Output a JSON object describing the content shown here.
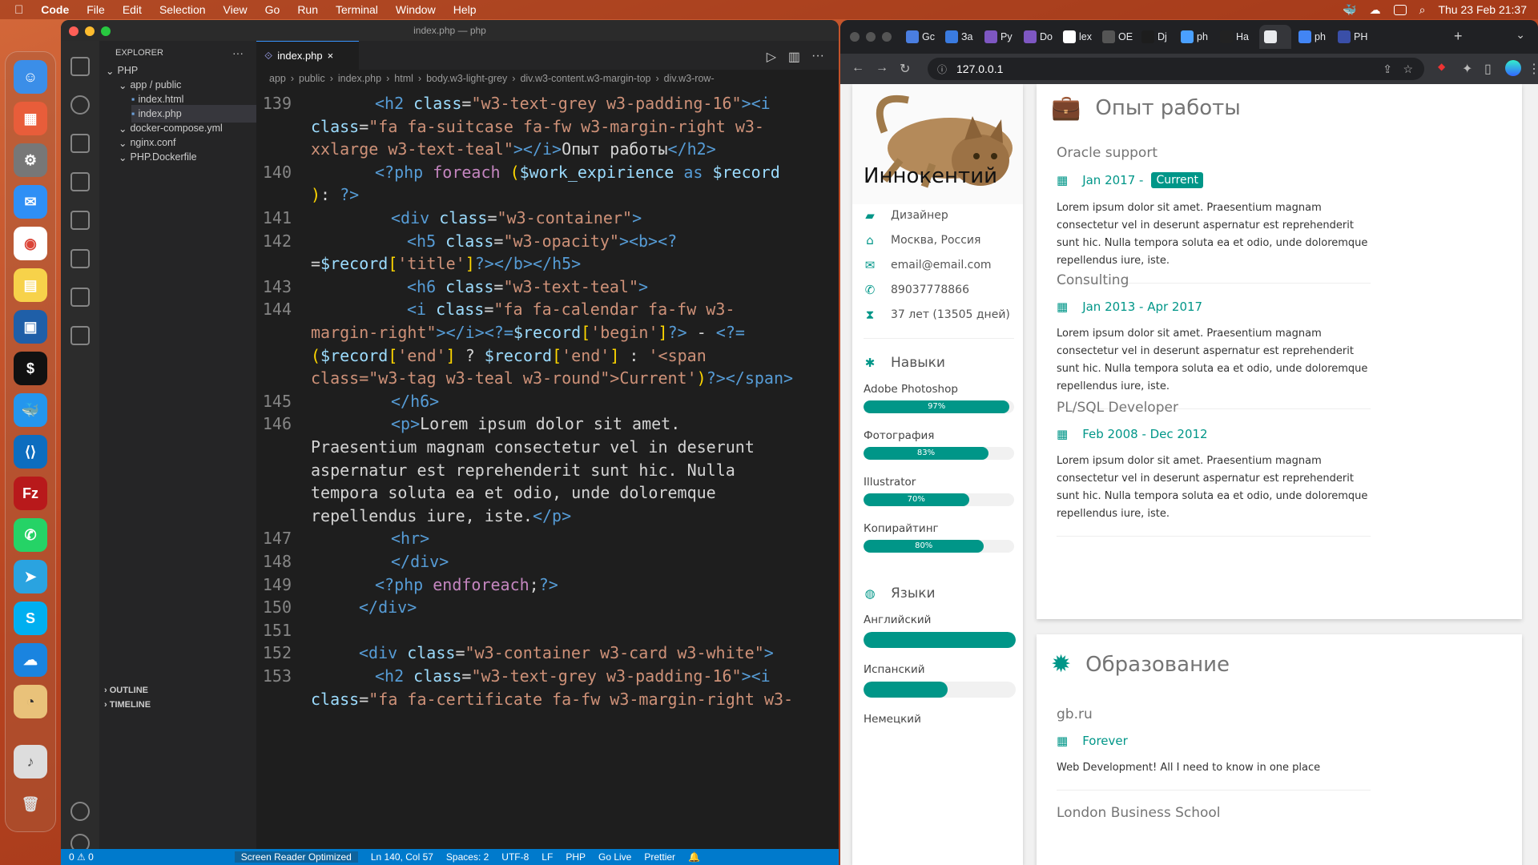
{
  "menubar": {
    "app": "Code",
    "items": [
      "File",
      "Edit",
      "Selection",
      "View",
      "Go",
      "Run",
      "Terminal",
      "Window",
      "Help"
    ],
    "clock": "Thu 23 Feb 21:37"
  },
  "vscode": {
    "title": "index.php — php",
    "explorer_label": "EXPLORER",
    "tree": [
      {
        "label": "PHP",
        "depth": 0
      },
      {
        "label": "app / public",
        "depth": 1
      },
      {
        "label": "index.html",
        "depth": 2
      },
      {
        "label": "index.php",
        "depth": 2,
        "active": true
      },
      {
        "label": "docker-compose.yml",
        "depth": 1
      },
      {
        "label": "nginx.conf",
        "depth": 1
      },
      {
        "label": "PHP.Dockerfile",
        "depth": 1
      }
    ],
    "outline": "OUTLINE",
    "timeline": "TIMELINE",
    "tab": "index.php",
    "breadcrumbs": [
      "app",
      "public",
      "index.php",
      "html",
      "body.w3-light-grey",
      "div.w3-content.w3-margin-top",
      "div.w3-row-"
    ],
    "lines": [
      {
        "n": "139",
        "parts": [
          [
            "t",
            "<h2 "
          ],
          [
            "a",
            "class"
          ],
          [
            "p",
            "="
          ],
          [
            "s",
            "\"w3-text-grey w3-padding-16\""
          ],
          [
            "t",
            "><i"
          ]
        ]
      },
      {
        "n": "",
        "parts": [
          [
            "a",
            "class"
          ],
          [
            "p",
            "="
          ],
          [
            "s",
            "\"fa fa-suitcase fa-fw w3-margin-right w3-"
          ]
        ]
      },
      {
        "n": "",
        "parts": [
          [
            "s",
            "xxlarge w3-text-teal\""
          ],
          [
            "t",
            "></i>"
          ],
          [
            "p",
            "Опыт работы"
          ],
          [
            "t",
            "</h2>"
          ]
        ]
      },
      {
        "n": "140",
        "parts": [
          [
            "t",
            "<?php "
          ],
          [
            "k",
            "foreach "
          ],
          [
            "y",
            "("
          ],
          [
            "v",
            "$work_expirience "
          ],
          [
            "t",
            "as "
          ],
          [
            "v",
            "$record"
          ]
        ]
      },
      {
        "n": "",
        "parts": [
          [
            "y",
            ")"
          ],
          [
            "p",
            ": "
          ],
          [
            "t",
            "?>"
          ]
        ]
      },
      {
        "n": "141",
        "parts": [
          [
            "t",
            "<div "
          ],
          [
            "a",
            "class"
          ],
          [
            "p",
            "="
          ],
          [
            "s",
            "\"w3-container\""
          ],
          [
            "t",
            ">"
          ]
        ]
      },
      {
        "n": "142",
        "parts": [
          [
            "t",
            "<h5 "
          ],
          [
            "a",
            "class"
          ],
          [
            "p",
            "="
          ],
          [
            "s",
            "\"w3-opacity\""
          ],
          [
            "t",
            "><b><?"
          ]
        ]
      },
      {
        "n": "",
        "parts": [
          [
            "p",
            "="
          ],
          [
            "v",
            "$record"
          ],
          [
            "y",
            "["
          ],
          [
            "s",
            "'title'"
          ],
          [
            "y",
            "]"
          ],
          [
            "t",
            "?></b></h5>"
          ]
        ]
      },
      {
        "n": "143",
        "parts": [
          [
            "t",
            "<h6 "
          ],
          [
            "a",
            "class"
          ],
          [
            "p",
            "="
          ],
          [
            "s",
            "\"w3-text-teal\""
          ],
          [
            "t",
            ">"
          ]
        ]
      },
      {
        "n": "144",
        "parts": [
          [
            "t",
            "<i "
          ],
          [
            "a",
            "class"
          ],
          [
            "p",
            "="
          ],
          [
            "s",
            "\"fa fa-calendar fa-fw w3-"
          ]
        ]
      },
      {
        "n": "",
        "parts": [
          [
            "s",
            "margin-right\""
          ],
          [
            "t",
            "></i><?="
          ],
          [
            "v",
            "$record"
          ],
          [
            "y",
            "["
          ],
          [
            "s",
            "'begin'"
          ],
          [
            "y",
            "]"
          ],
          [
            "t",
            "?>"
          ],
          [
            "p",
            " - "
          ],
          [
            "t",
            "<?="
          ]
        ]
      },
      {
        "n": "",
        "parts": [
          [
            "y",
            "("
          ],
          [
            "v",
            "$record"
          ],
          [
            "y",
            "["
          ],
          [
            "s",
            "'end'"
          ],
          [
            "y",
            "]"
          ],
          [
            "p",
            " ? "
          ],
          [
            "v",
            "$record"
          ],
          [
            "y",
            "["
          ],
          [
            "s",
            "'end'"
          ],
          [
            "y",
            "]"
          ],
          [
            "p",
            " : "
          ],
          [
            "s",
            "'<span"
          ]
        ]
      },
      {
        "n": "",
        "parts": [
          [
            "s",
            "class=\"w3-tag w3-teal w3-round\">Current'"
          ],
          [
            "y",
            ")"
          ],
          [
            "t",
            "?></span>"
          ]
        ]
      },
      {
        "n": "145",
        "parts": [
          [
            "t",
            "</h6>"
          ]
        ]
      },
      {
        "n": "146",
        "parts": [
          [
            "t",
            "<p>"
          ],
          [
            "p",
            "Lorem ipsum dolor sit amet."
          ]
        ]
      },
      {
        "n": "",
        "parts": [
          [
            "p",
            "Praesentium magnam consectetur vel in deserunt"
          ]
        ]
      },
      {
        "n": "",
        "parts": [
          [
            "p",
            "aspernatur est reprehenderit sunt hic. Nulla"
          ]
        ]
      },
      {
        "n": "",
        "parts": [
          [
            "p",
            "tempora soluta ea et odio, unde doloremque"
          ]
        ]
      },
      {
        "n": "",
        "parts": [
          [
            "p",
            "repellendus iure, iste."
          ],
          [
            "t",
            "</p>"
          ]
        ]
      },
      {
        "n": "147",
        "parts": [
          [
            "t",
            "<hr>"
          ]
        ]
      },
      {
        "n": "148",
        "parts": [
          [
            "t",
            "</div>"
          ]
        ]
      },
      {
        "n": "149",
        "parts": [
          [
            "t",
            "<?php "
          ],
          [
            "k",
            "endforeach"
          ],
          [
            "p",
            ";"
          ],
          [
            "t",
            "?>"
          ]
        ]
      },
      {
        "n": "150",
        "parts": [
          [
            "t",
            "</div>"
          ]
        ]
      },
      {
        "n": "151",
        "parts": []
      },
      {
        "n": "152",
        "parts": [
          [
            "t",
            "<div "
          ],
          [
            "a",
            "class"
          ],
          [
            "p",
            "="
          ],
          [
            "s",
            "\"w3-container w3-card w3-white\""
          ],
          [
            "t",
            ">"
          ]
        ]
      },
      {
        "n": "153",
        "parts": [
          [
            "t",
            "<h2 "
          ],
          [
            "a",
            "class"
          ],
          [
            "p",
            "="
          ],
          [
            "s",
            "\"w3-text-grey w3-padding-16\""
          ],
          [
            "t",
            "><i"
          ]
        ]
      },
      {
        "n": "",
        "parts": [
          [
            "a",
            "class"
          ],
          [
            "p",
            "="
          ],
          [
            "s",
            "\"fa fa-certificate fa-fw w3-margin-right w3-"
          ]
        ]
      }
    ],
    "status": {
      "problems": "0 ⚠ 0",
      "reader": "Screen Reader Optimized",
      "pos": "Ln 140, Col 57",
      "spaces": "Spaces: 2",
      "enc": "UTF-8",
      "eol": "LF",
      "lang": "PHP",
      "live": "Go Live",
      "prettier": "Prettier"
    }
  },
  "chrome": {
    "tabs": [
      "Gc",
      "За",
      "Py",
      "Do",
      "lex",
      "OE",
      "Dj",
      "ph",
      "Ha",
      "",
      "ph",
      "PH"
    ],
    "url": "127.0.0.1",
    "resume": {
      "name": "Иннокентий",
      "info": [
        {
          "icon": "briefcase-icon",
          "text": "Дизайнер"
        },
        {
          "icon": "home-icon",
          "text": "Москва, Россия"
        },
        {
          "icon": "envelope-icon",
          "text": "email@email.com"
        },
        {
          "icon": "phone-icon",
          "text": "89037778866"
        },
        {
          "icon": "hourglass-icon",
          "text": "37 лет (13505 дней)"
        }
      ],
      "skills_title": "Навыки",
      "skills": [
        {
          "name": "Adobe Photoshop",
          "pct": 97,
          "label": "97%"
        },
        {
          "name": "Фотография",
          "pct": 83,
          "label": "83%"
        },
        {
          "name": "Illustrator",
          "pct": 70,
          "label": "70%"
        },
        {
          "name": "Копирайтинг",
          "pct": 80,
          "label": "80%"
        }
      ],
      "lang_title": "Языки",
      "langs": [
        {
          "name": "Английский",
          "pct": 100
        },
        {
          "name": "Испанский",
          "pct": 55
        },
        {
          "name": "Немецкий",
          "pct": 0
        }
      ],
      "work_title": "Опыт работы",
      "jobs": [
        {
          "title": "Oracle support",
          "date": "Jan 2017 -",
          "tag": "Current",
          "text": "Lorem ipsum dolor sit amet. Praesentium magnam consectetur vel in deserunt aspernatur est reprehenderit sunt hic. Nulla tempora soluta ea et odio, unde doloremque repellendus iure, iste."
        },
        {
          "title": "Consulting",
          "date": "Jan 2013 - Apr 2017",
          "tag": "",
          "text": "Lorem ipsum dolor sit amet. Praesentium magnam consectetur vel in deserunt aspernatur est reprehenderit sunt hic. Nulla tempora soluta ea et odio, unde doloremque repellendus iure, iste."
        },
        {
          "title": "PL/SQL Developer",
          "date": "Feb 2008 - Dec 2012",
          "tag": "",
          "text": "Lorem ipsum dolor sit amet. Praesentium magnam consectetur vel in deserunt aspernatur est reprehenderit sunt hic. Nulla tempora soluta ea et odio, unde doloremque repellendus iure, iste."
        }
      ],
      "edu_title": "Образование",
      "edu": [
        {
          "title": "gb.ru",
          "date": "Forever",
          "text": "Web Development! All I need to know in one place"
        },
        {
          "title": "London Business School"
        }
      ]
    }
  },
  "colors": {
    "teal": "#009688",
    "vscode_blue": "#007acc"
  }
}
